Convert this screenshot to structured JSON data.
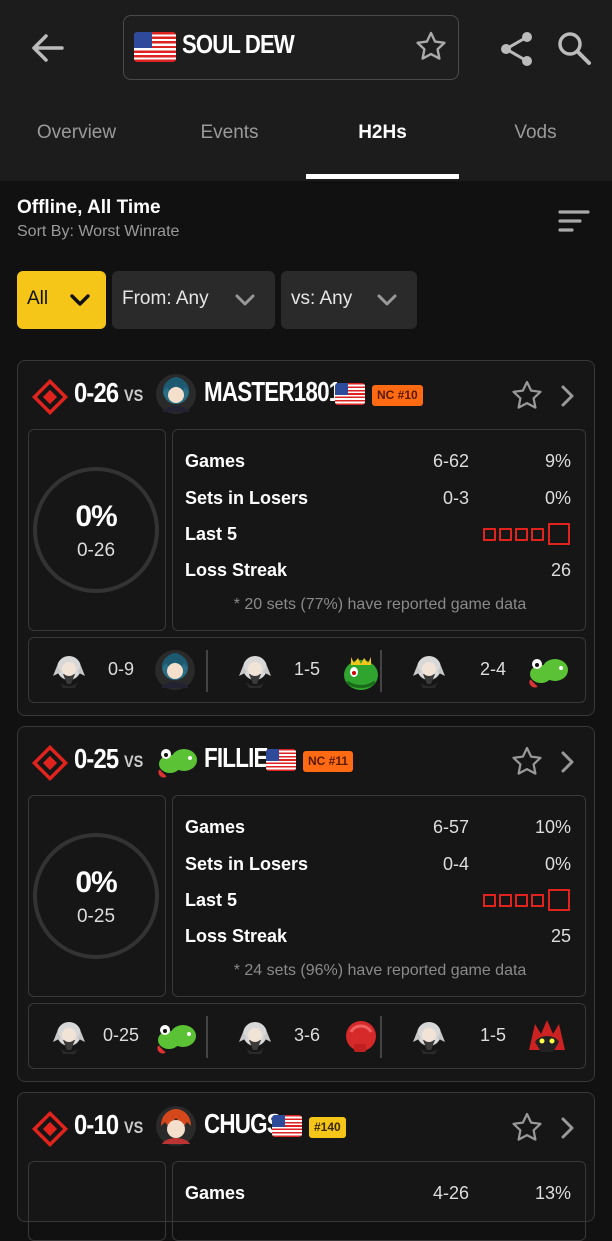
{
  "header": {
    "player_name": "SOUL DEW"
  },
  "tabs": [
    {
      "label": "Overview"
    },
    {
      "label": "Events"
    },
    {
      "label": "H2Hs",
      "active": true
    },
    {
      "label": "Vods"
    }
  ],
  "filters": {
    "title": "Offline, All Time",
    "sort_by": "Sort By: Worst Winrate",
    "chips": [
      {
        "label": "All",
        "selected": true
      },
      {
        "label": "From: Any"
      },
      {
        "label": "vs: Any"
      }
    ]
  },
  "cards": [
    {
      "record": "0-26",
      "vs": "VS",
      "opponent": "MASTER1801",
      "badge": "NC #10",
      "pct": "0%",
      "pct_sub": "0-26",
      "games_label": "Games",
      "games_record": "6-62",
      "games_pct": "9%",
      "losers_label": "Sets in Losers",
      "losers_record": "0-3",
      "losers_pct": "0%",
      "last5_label": "Last 5",
      "last5": [
        "L",
        "L",
        "L",
        "L",
        "L"
      ],
      "streak_label": "Loss Streak",
      "streak": "26",
      "note": "* 20 sets (77%) have reported game data",
      "matchups": [
        {
          "score": "0-9",
          "opp_icon": "byleth-icon"
        },
        {
          "score": "1-5",
          "opp_icon": "king-k-rool-icon"
        },
        {
          "score": "2-4",
          "opp_icon": "yoshi-icon"
        }
      ]
    },
    {
      "record": "0-25",
      "vs": "VS",
      "opponent": "FILLIE",
      "badge": "NC #11",
      "pct": "0%",
      "pct_sub": "0-25",
      "games_label": "Games",
      "games_record": "6-57",
      "games_pct": "10%",
      "losers_label": "Sets in Losers",
      "losers_record": "0-4",
      "losers_pct": "0%",
      "last5_label": "Last 5",
      "last5": [
        "L",
        "L",
        "L",
        "L",
        "L"
      ],
      "streak_label": "Loss Streak",
      "streak": "25",
      "note": "* 24 sets (96%) have reported game data",
      "matchups": [
        {
          "score": "0-25",
          "opp_icon": "yoshi-icon"
        },
        {
          "score": "3-6",
          "opp_icon": "little-mac-icon"
        },
        {
          "score": "1-5",
          "opp_icon": "incineroar-icon"
        }
      ]
    },
    {
      "record": "0-10",
      "vs": "VS",
      "opponent": "CHUGS",
      "badge": "#140",
      "games_label": "Games",
      "games_record": "4-26",
      "games_pct": "13%"
    }
  ],
  "colors": {
    "accent_yellow": "#f5c518",
    "badge_orange": "#ff6a13",
    "loss_red": "#e0231d"
  }
}
